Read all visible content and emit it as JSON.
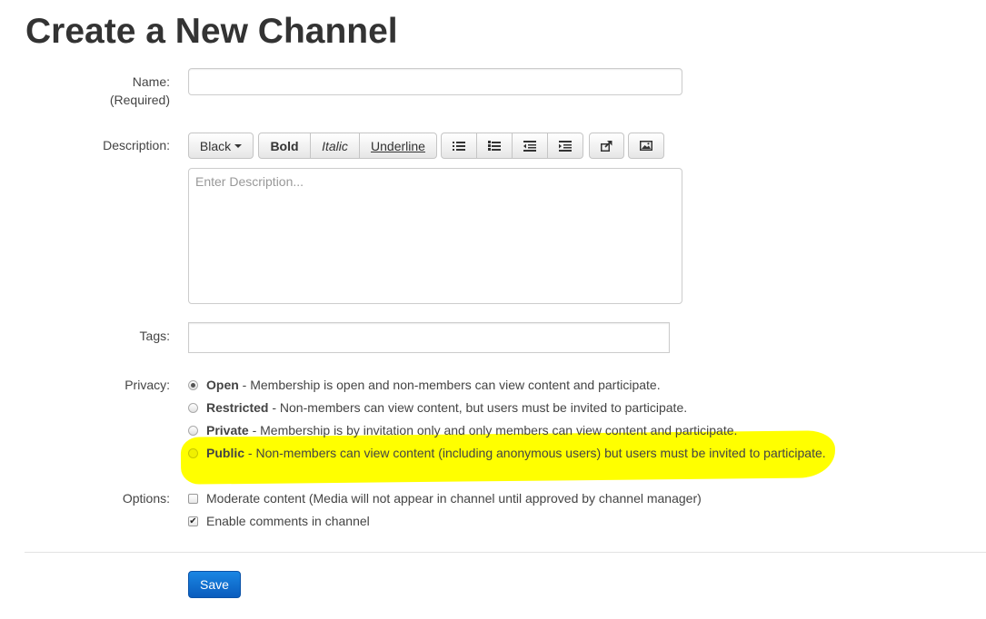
{
  "page": {
    "title": "Create a New Channel"
  },
  "name_field": {
    "label": "Name:",
    "required_note": "(Required)",
    "value": ""
  },
  "description": {
    "label": "Description:",
    "placeholder": "Enter Description...",
    "toolbar": {
      "color_label": "Black",
      "bold_label": "Bold",
      "italic_label": "Italic",
      "underline_label": "Underline",
      "icons": [
        "unordered-list-icon",
        "ordered-list-icon",
        "outdent-icon",
        "indent-icon",
        "share-icon",
        "image-icon"
      ]
    }
  },
  "tags": {
    "label": "Tags:",
    "value": ""
  },
  "privacy": {
    "label": "Privacy:",
    "selected": "Open",
    "options": [
      {
        "name": "Open",
        "desc": "- Membership is open and non-members can view content and participate."
      },
      {
        "name": "Restricted",
        "desc": "- Non-members can view content, but users must be invited to participate."
      },
      {
        "name": "Private",
        "desc": "- Membership is by invitation only and only members can view content and participate."
      },
      {
        "name": "Public",
        "desc": "- Non-members can view content (including anonymous users) but users must be invited to participate."
      }
    ],
    "highlight_color": "#ffff00"
  },
  "options": {
    "label": "Options:",
    "items": [
      {
        "text": "Moderate content (Media will not appear in channel until approved by channel manager)",
        "checked": false
      },
      {
        "text": "Enable comments in channel",
        "checked": true
      }
    ]
  },
  "actions": {
    "save_label": "Save",
    "save_color": "#0a6fd6"
  }
}
